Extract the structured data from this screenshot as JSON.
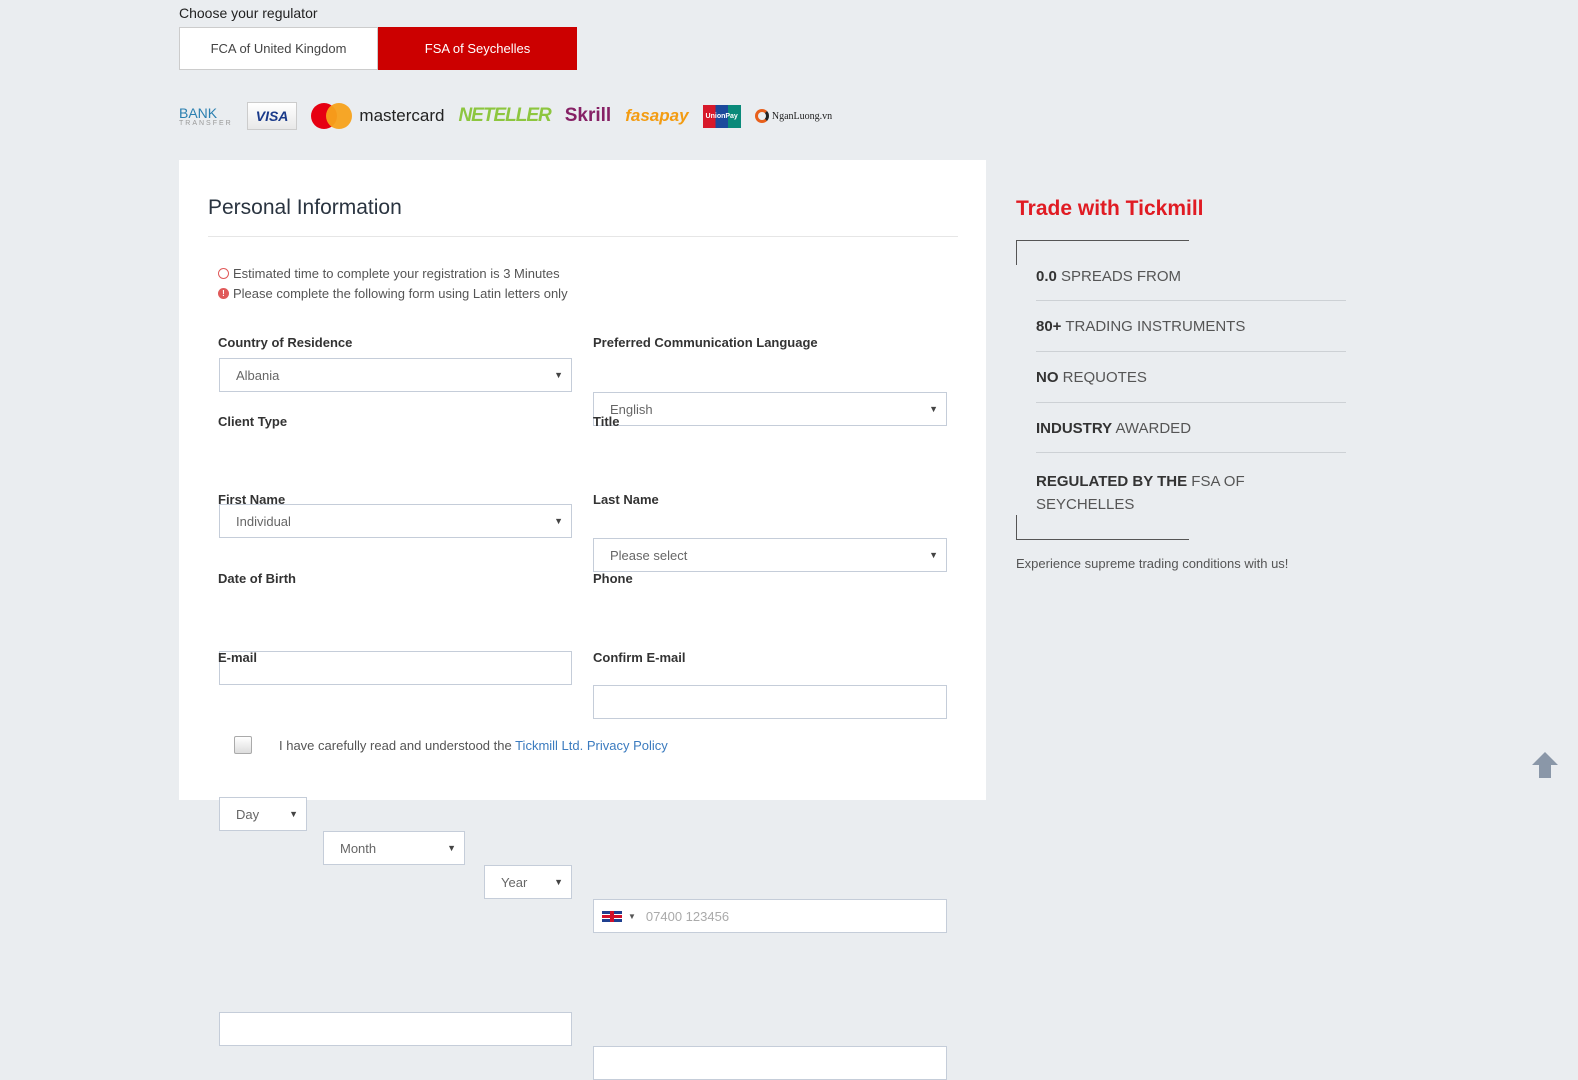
{
  "regulator": {
    "label": "Choose your regulator",
    "options": [
      "FCA of United Kingdom",
      "FSA of Seychelles"
    ],
    "selected": "FSA of Seychelles",
    "accent": "#cc0000"
  },
  "payments": [
    {
      "name": "bank-transfer",
      "text": "BANK",
      "sub": "TRANSFER"
    },
    {
      "name": "visa",
      "text": "VISA"
    },
    {
      "name": "mastercard",
      "text": "mastercard"
    },
    {
      "name": "neteller",
      "text": "NETELLER"
    },
    {
      "name": "skrill",
      "text": "Skrill"
    },
    {
      "name": "fasapay",
      "text": "fasapay"
    },
    {
      "name": "unionpay",
      "text": "UnionPay"
    },
    {
      "name": "nganluong",
      "text": "NganLuong.vn"
    }
  ],
  "form": {
    "title": "Personal Information",
    "notes": [
      "Estimated time to complete your registration is 3 Minutes",
      "Please complete the following form using Latin letters only"
    ],
    "country": {
      "label": "Country of Residence",
      "value": "Albania"
    },
    "language": {
      "label": "Preferred Communication Language",
      "value": "English"
    },
    "client_type": {
      "label": "Client Type",
      "value": "Individual"
    },
    "title_field": {
      "label": "Title",
      "value": "Please select"
    },
    "first_name": {
      "label": "First Name",
      "value": ""
    },
    "last_name": {
      "label": "Last Name",
      "value": ""
    },
    "dob": {
      "label": "Date of Birth",
      "day": "Day",
      "month": "Month",
      "year": "Year"
    },
    "phone": {
      "label": "Phone",
      "placeholder": "07400 123456"
    },
    "email": {
      "label": "E-mail",
      "value": ""
    },
    "confirm_email": {
      "label": "Confirm E-mail",
      "value": ""
    },
    "consent": {
      "text": "I have carefully read and understood the ",
      "link": "Tickmill Ltd. Privacy Policy",
      "checked": false
    }
  },
  "side": {
    "title": "Trade with Tickmill",
    "features": [
      {
        "bold": "0.0",
        "rest": " SPREADS FROM"
      },
      {
        "bold": "80+",
        "rest": " TRADING INSTRUMENTS"
      },
      {
        "bold": "NO",
        "rest": " REQUOTES"
      },
      {
        "bold": "INDUSTRY",
        "rest": " AWARDED"
      },
      {
        "bold": "REGULATED BY THE",
        "rest": " FSA OF SEYCHELLES"
      }
    ],
    "tagline": "Experience supreme trading conditions with us!",
    "accent": "#e01b23"
  }
}
